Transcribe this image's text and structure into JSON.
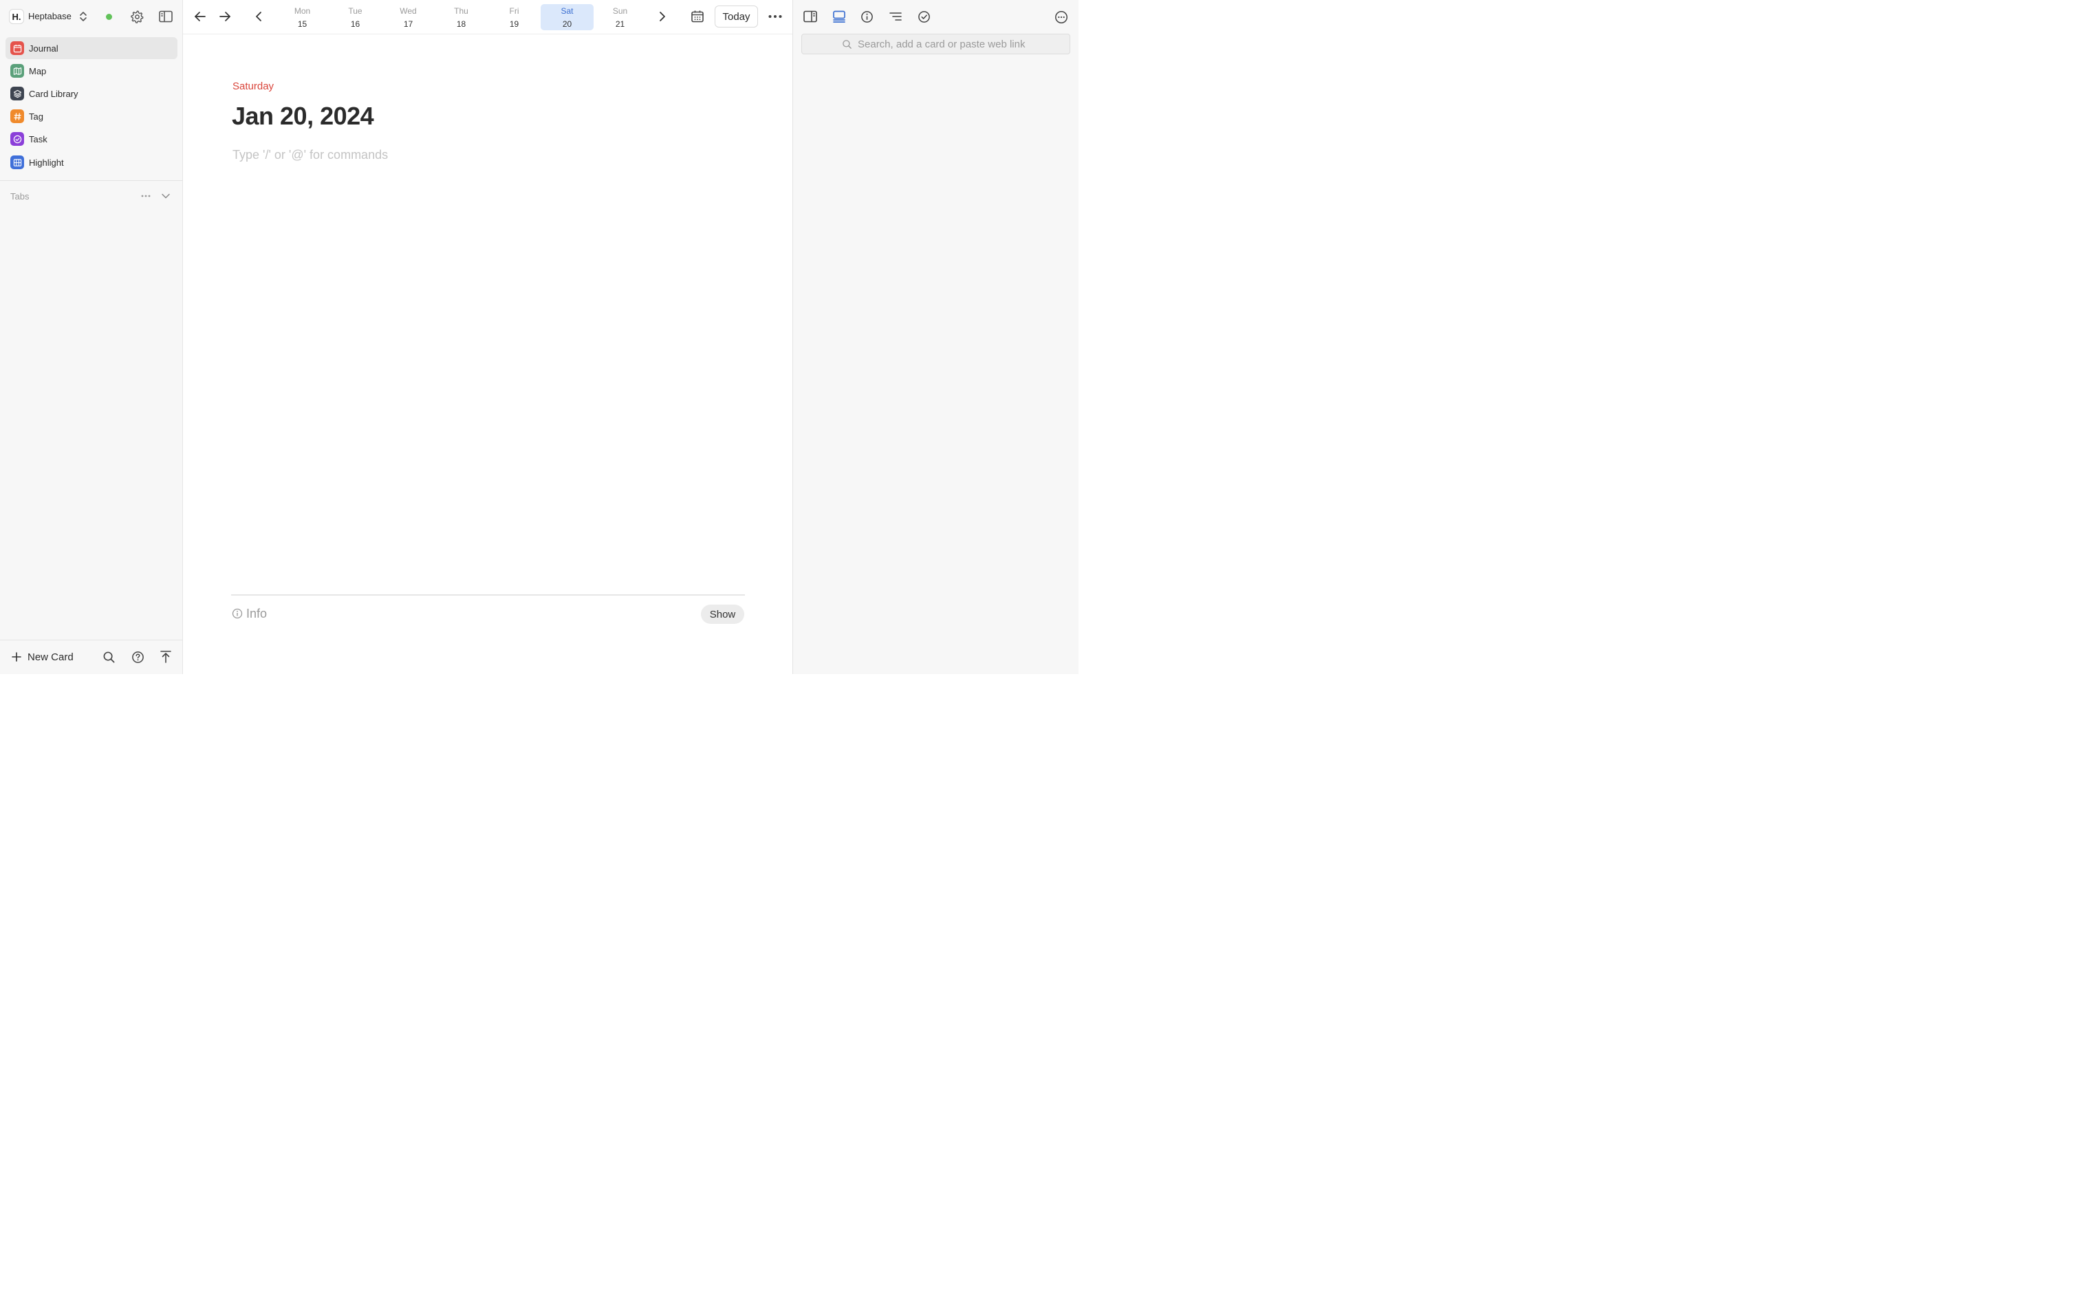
{
  "sidebar": {
    "workspace_logo": "H.",
    "workspace_name": "Heptabase",
    "sync_status_color": "#62c25a",
    "items": [
      {
        "label": "Journal",
        "icon": "calendar-icon",
        "color": "#e5534b",
        "active": true
      },
      {
        "label": "Map",
        "icon": "map-icon",
        "color": "#5aa07a"
      },
      {
        "label": "Card Library",
        "icon": "layers-icon",
        "color": "#3d4450"
      },
      {
        "label": "Tag",
        "icon": "hash-icon",
        "color": "#f08a2c"
      },
      {
        "label": "Task",
        "icon": "check-circle-icon",
        "color": "#8b3fd9"
      },
      {
        "label": "Highlight",
        "icon": "highlight-icon",
        "color": "#3f6fd9"
      }
    ],
    "tabs_label": "Tabs",
    "new_card_label": "New Card"
  },
  "week": {
    "days": [
      {
        "name": "Mon",
        "num": "15"
      },
      {
        "name": "Tue",
        "num": "16"
      },
      {
        "name": "Wed",
        "num": "17"
      },
      {
        "name": "Thu",
        "num": "18"
      },
      {
        "name": "Fri",
        "num": "19"
      },
      {
        "name": "Sat",
        "num": "20",
        "active": true
      },
      {
        "name": "Sun",
        "num": "21"
      }
    ],
    "today_label": "Today",
    "active_color": "#3b6fd1"
  },
  "journal": {
    "weekday": "Saturday",
    "title": "Jan 20, 2024",
    "placeholder": "Type '/' or '@' for commands",
    "info_label": "Info",
    "show_label": "Show"
  },
  "right_panel": {
    "search_placeholder": "Search, add a card or paste web link"
  }
}
